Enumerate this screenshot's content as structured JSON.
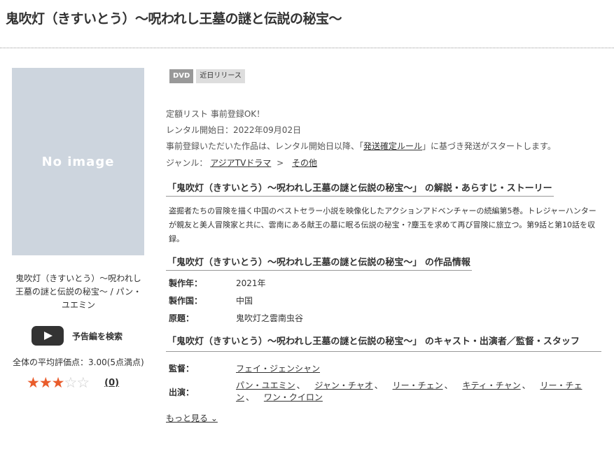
{
  "page": {
    "title": "鬼吹灯（きすいとう）～呪われし王墓の謎と伝説の秘宝～"
  },
  "left": {
    "no_image_text": "No image",
    "title_line": "鬼吹灯（きすいとう）～呪われし王墓の謎と伝説の秘宝～ / パン・ユエミン",
    "trailer_label": "予告編を検索",
    "average_label": "全体の平均評価点：3.00(5点満点)",
    "rating_value": 3,
    "rating_max": 5,
    "review_count": "(0)"
  },
  "badges": {
    "format": "DVD",
    "status": "近日リリース"
  },
  "info": {
    "line1": "定額リスト 事前登録OK！",
    "line2": "レンタル開始日：2022年09月02日",
    "line3_pre": "事前登録いただいた作品は、レンタル開始日以降、「",
    "line3_link": "発送確定ルール",
    "line3_post": "」に基づき発送がスタートします。",
    "genre_label": "ジャンル：",
    "genre_1": "アジアTVドラマ",
    "genre_sep": ">",
    "genre_2": "その他"
  },
  "synopsis": {
    "heading": "「鬼吹灯（きすいとう）～呪われし王墓の謎と伝説の秘宝～」 の解説・あらすじ・ストーリー",
    "text": "盗掘者たちの冒険を描く中国のベストセラー小説を映像化したアクションアドベンチャーの続編第5巻。トレジャーハンターが親友と美人冒険家と共に、雲南にある献王の墓に眠る伝説の秘宝・?塵玉を求めて再び冒険に旅立つ。第9話と第10話を収録。"
  },
  "work_info": {
    "heading": "「鬼吹灯（きすいとう）～呪われし王墓の謎と伝説の秘宝～」 の作品情報",
    "rows": [
      {
        "label": "製作年：",
        "value": "2021年"
      },
      {
        "label": "製作国：",
        "value": "中国"
      },
      {
        "label": "原題：",
        "value": "鬼吹灯之雲南虫谷"
      }
    ]
  },
  "cast": {
    "heading": "「鬼吹灯（きすいとう）～呪われし王墓の謎と伝説の秘宝～」 のキャスト・出演者／監督・スタッフ",
    "director_label": "監督：",
    "director": "フェイ・ジェンシャン",
    "cast_label": "出演：",
    "cast_members": [
      "パン・ユエミン",
      "ジャン・チャオ",
      "リー・チェン",
      "キティ・チャン",
      "リー・チェン",
      "ワン・クイロン"
    ],
    "separator": "、",
    "more_label": "もっと見る ⌄"
  },
  "colors": {
    "star_on": "#e95c2b",
    "star_off": "#cccccc",
    "noimage_bg": "#cdd5de"
  }
}
